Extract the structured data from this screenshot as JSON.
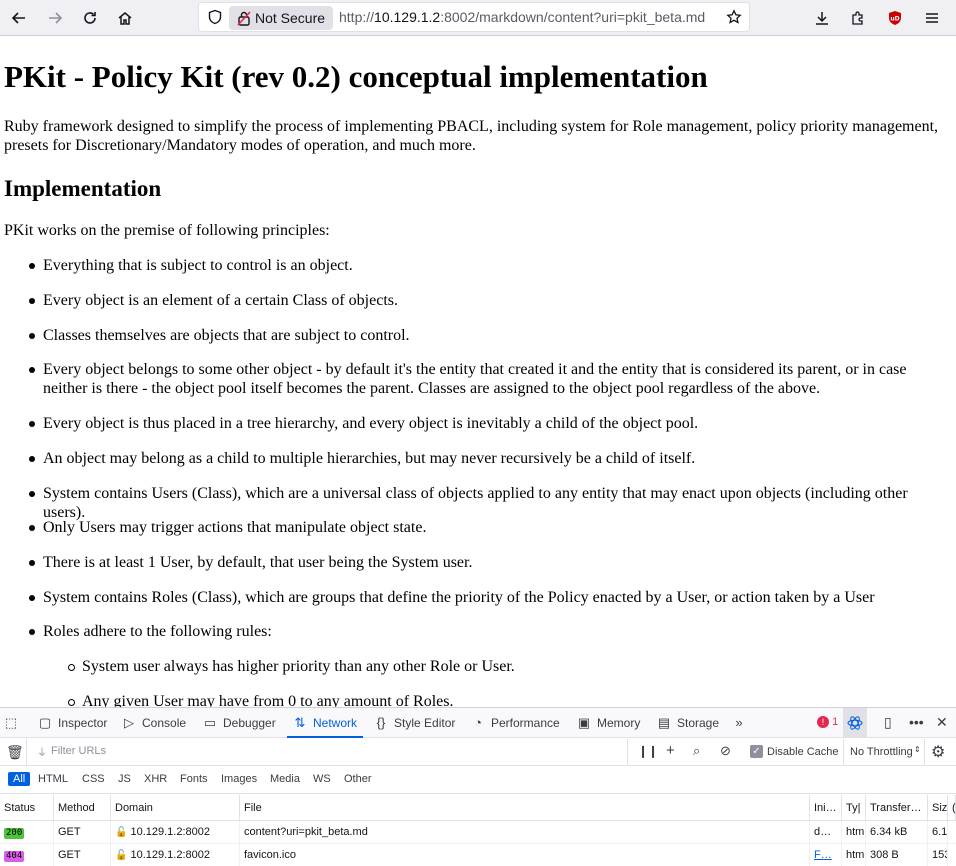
{
  "browser": {
    "not_secure_label": "Not Secure",
    "url_scheme": "http://",
    "url_host": "10.129.1.2",
    "url_rest": ":8002/markdown/content?uri=pkit_beta.md",
    "extension_badge": "uD"
  },
  "page": {
    "title": "PKit - Policy Kit (rev 0.2) conceptual implementation",
    "intro": "Ruby framework designed to simplify the process of implementing PBACL, including system for Role management, policy priority management, presets for Discretionary/Mandatory modes of operation, and much more.",
    "h2": "Implementation",
    "premise": "PKit works on the premise of following principles:",
    "items": [
      "Everything that is subject to control is an object.",
      "Every object is an element of a certain Class of objects.",
      "Classes themselves are objects that are subject to control.",
      "Every object belongs to some other object - by default it's the entity that created it and the entity that is considered its parent, or in case neither is there - the object pool itself becomes the parent. Classes are assigned to the object pool regardless of the above.",
      "Every object is thus placed in a tree hierarchy, and every object is inevitably a child of the object pool.",
      "An object may belong as a child to multiple hierarchies, but may never recursively be a child of itself.",
      "System contains Users (Class), which are a universal class of objects applied to any entity that may enact upon objects (including other users).",
      "Only Users may trigger actions that manipulate object state.",
      "There is at least 1 User, by default, that user being the System user.",
      "System contains Roles (Class), which are groups that define the priority of the Policy enacted by a User, or action taken by a User",
      "Roles adhere to the following rules:"
    ],
    "subitems": [
      "System user always has higher priority than any other Role or User.",
      "Any given User may have from 0 to any amount of Roles."
    ]
  },
  "devtools": {
    "tabs": [
      "Inspector",
      "Console",
      "Debugger",
      "Network",
      "Style Editor",
      "Performance",
      "Memory",
      "Storage"
    ],
    "active_tab": "Network",
    "error_count": "1",
    "filter_placeholder": "Filter URLs",
    "disable_cache_label": "Disable Cache",
    "throttling": "No Throttling",
    "types": [
      "All",
      "HTML",
      "CSS",
      "JS",
      "XHR",
      "Fonts",
      "Images",
      "Media",
      "WS",
      "Other"
    ],
    "columns": [
      "Status",
      "Method",
      "Domain",
      "File",
      "Ini…",
      "Ty|",
      "Transfer…",
      "Siz",
      "("
    ],
    "rows": [
      {
        "status": "200",
        "status_color": "#4ec43a",
        "method": "GET",
        "domain": "10.129.1.2:8002",
        "file": "content?uri=pkit_beta.md",
        "initiator": "d…",
        "type": "htm",
        "transferred": "6.34 kB",
        "size": "6.1!"
      },
      {
        "status": "404",
        "status_color": "#d95ee8",
        "method": "GET",
        "domain": "10.129.1.2:8002",
        "file": "favicon.ico",
        "initiator": "F…",
        "type": "htm",
        "transferred": "308 B",
        "size": "153"
      }
    ]
  }
}
